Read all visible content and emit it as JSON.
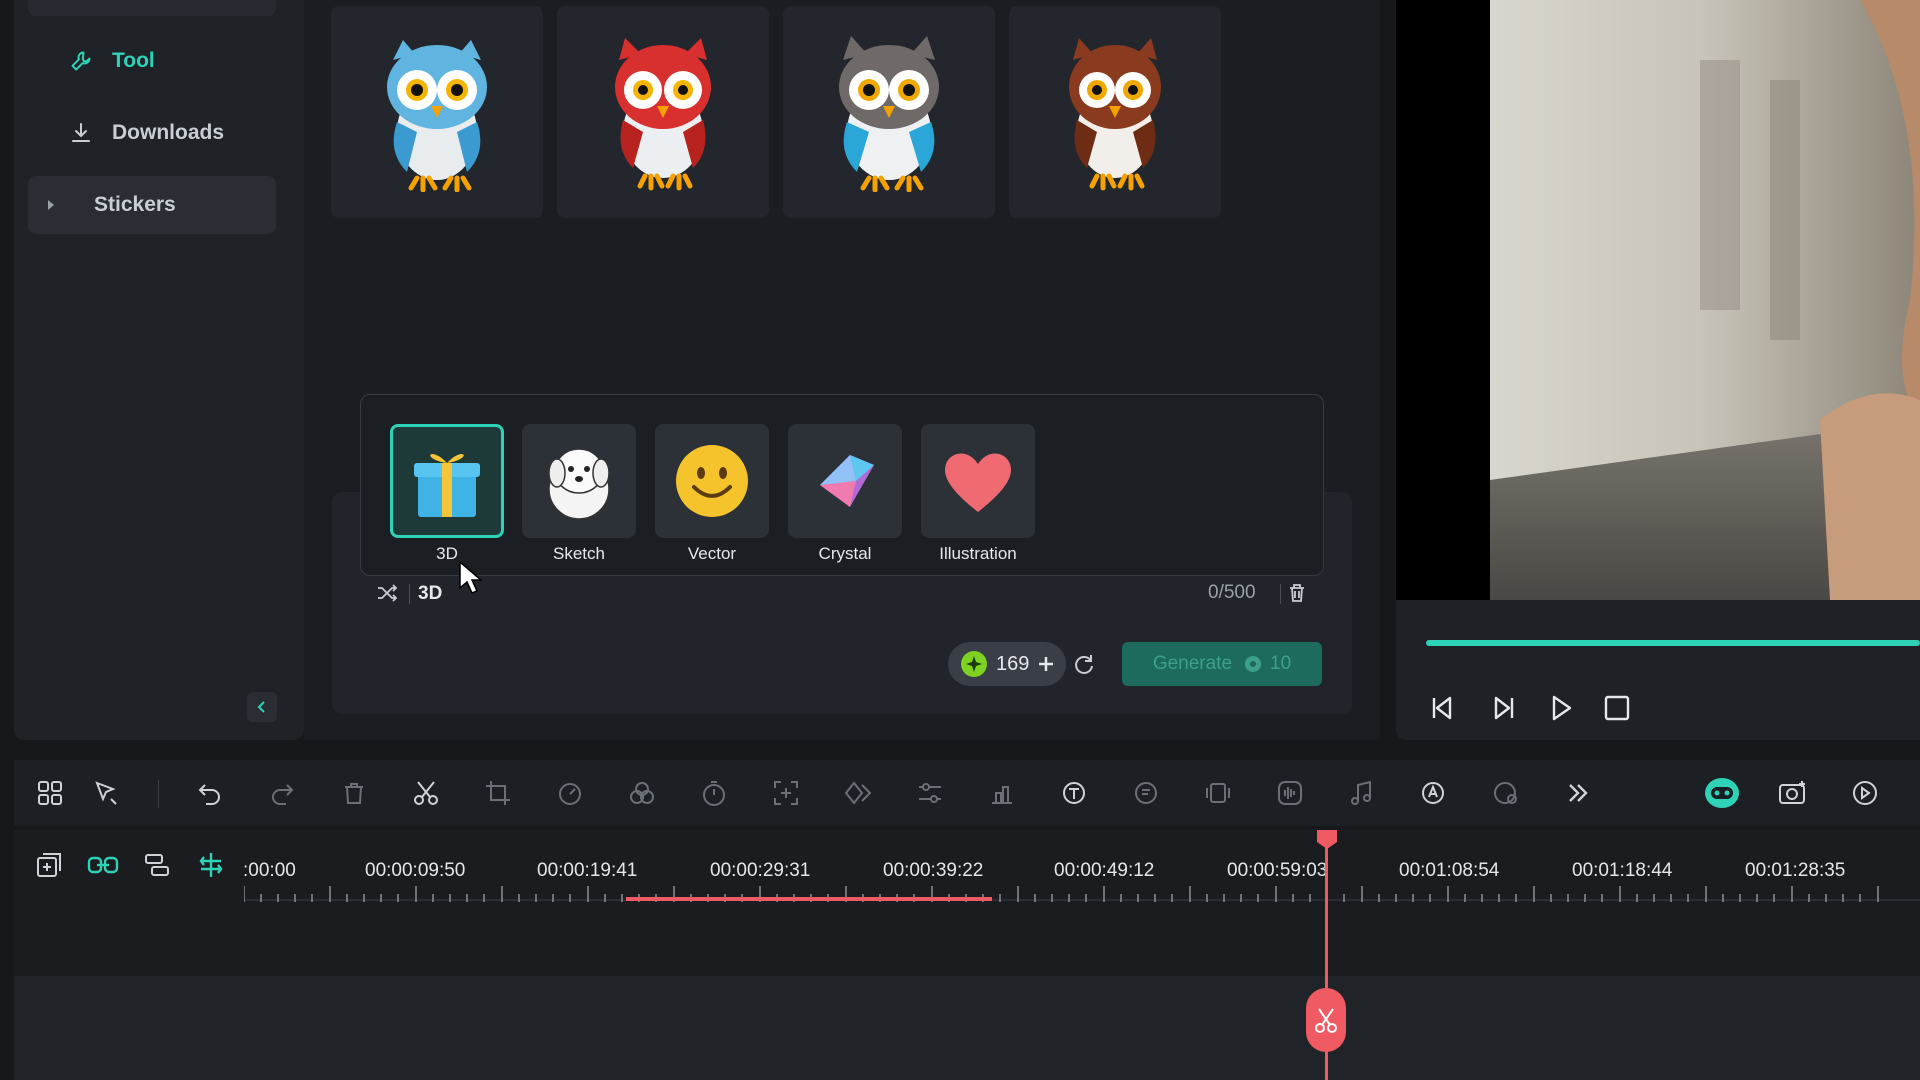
{
  "sidebar": {
    "items": [
      {
        "label": "Tool",
        "icon": "wrench-icon",
        "active": true
      },
      {
        "label": "Downloads",
        "icon": "download-icon"
      },
      {
        "label": "Stickers",
        "icon": "caret-right-icon"
      }
    ],
    "collapse_icon": "chevron-left-icon"
  },
  "stickers": {
    "items": [
      {
        "icon": "owl-blue-icon"
      },
      {
        "icon": "owl-red-icon"
      },
      {
        "icon": "owl-gray-icon"
      },
      {
        "icon": "owl-brown-icon"
      }
    ]
  },
  "style_picker": {
    "options": [
      {
        "label": "3D",
        "icon": "gift-box-icon",
        "selected": true
      },
      {
        "label": "Sketch",
        "icon": "sketch-dog-icon"
      },
      {
        "label": "Vector",
        "icon": "smiley-icon"
      },
      {
        "label": "Crystal",
        "icon": "crystal-gem-icon"
      },
      {
        "label": "Illustration",
        "icon": "heart-icon"
      }
    ],
    "current_style": "3D",
    "char_count": "0/500"
  },
  "generate": {
    "credits": "169",
    "button_label": "Generate",
    "cost": "10"
  },
  "timeline": {
    "timecodes": [
      ":00:00",
      "00:00:09:50",
      "00:00:19:41",
      "00:00:29:31",
      "00:00:39:22",
      "00:00:49:12",
      "00:00:59:03",
      "00:01:08:54",
      "00:01:18:44",
      "00:01:28:35"
    ]
  },
  "colors": {
    "accent": "#2ed3b7",
    "playhead": "#f05a63",
    "generate_button": "#1c6b5c"
  }
}
